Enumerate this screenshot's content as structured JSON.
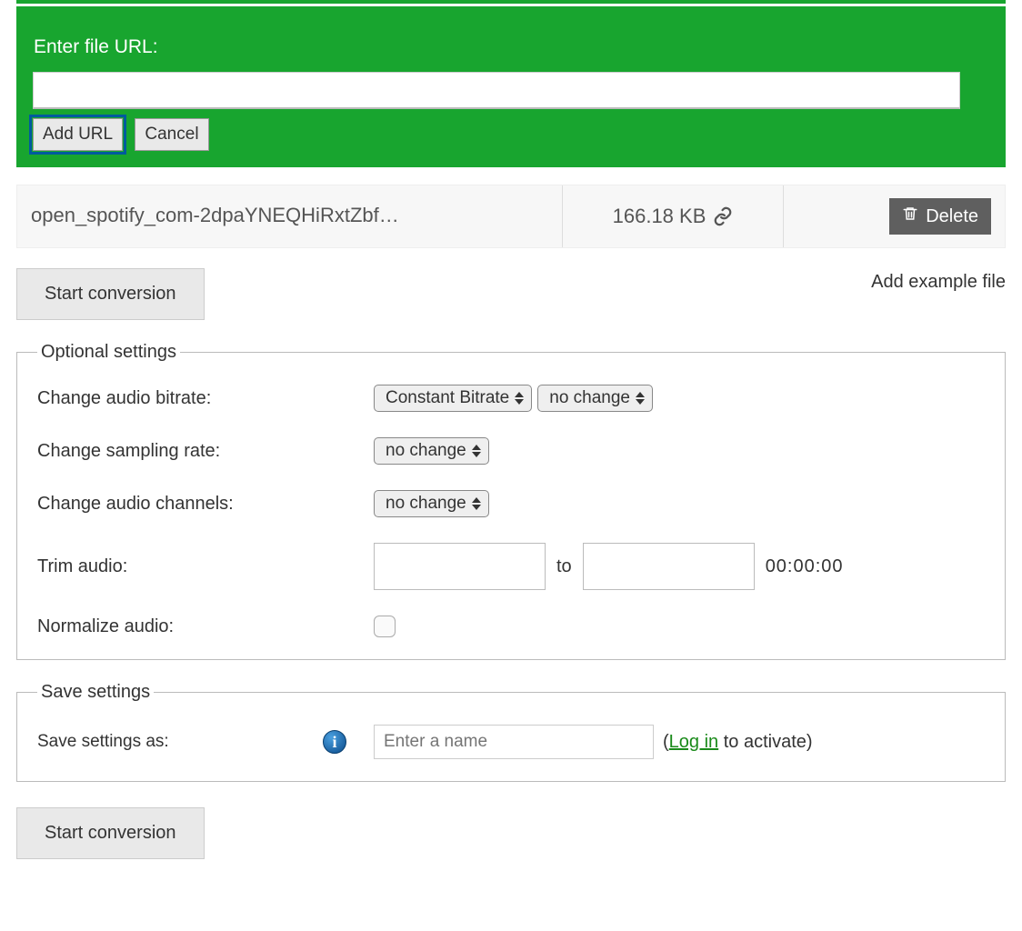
{
  "url_panel": {
    "label": "Enter file URL:",
    "add_button": "Add URL",
    "cancel_button": "Cancel"
  },
  "file": {
    "name": "open_spotify_com-2dpaYNEQHiRxtZbf…",
    "size": "166.18 KB",
    "delete_label": "Delete"
  },
  "actions": {
    "start_conversion": "Start conversion",
    "add_example": "Add example file"
  },
  "optional": {
    "legend": "Optional settings",
    "bitrate_label": "Change audio bitrate:",
    "bitrate_mode": "Constant Bitrate",
    "bitrate_value": "no change",
    "sampling_label": "Change sampling rate:",
    "sampling_value": "no change",
    "channels_label": "Change audio channels:",
    "channels_value": "no change",
    "trim_label": "Trim audio:",
    "trim_to": "to",
    "trim_duration": "00:00:00",
    "normalize_label": "Normalize audio:"
  },
  "save": {
    "legend": "Save settings",
    "label": "Save settings as:",
    "placeholder": "Enter a name",
    "login_text": "Log in",
    "activate_text": " to activate)"
  }
}
